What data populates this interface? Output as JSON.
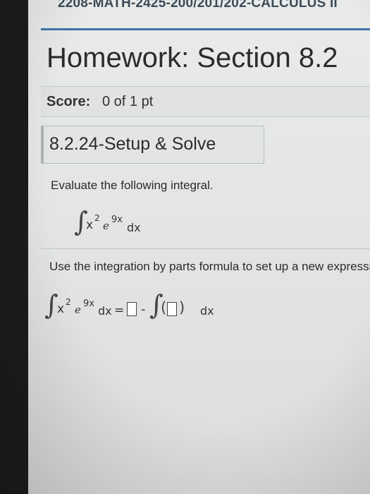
{
  "header": {
    "course_title": "2208-MATH-2425-200/201/202-CALCULUS II",
    "homework_title": "Homework: Section 8.2"
  },
  "score": {
    "label": "Score:",
    "value": "0 of 1 pt"
  },
  "question": {
    "id_label": "8.2.24-Setup & Solve",
    "prompt": "Evaluate the following integral.",
    "integral": {
      "integral_sign": "∫",
      "base": "x",
      "base_power": "2",
      "exp_base": "e",
      "exponent": "9x",
      "differential": "dx"
    },
    "instruction": "Use the integration by parts formula to set up a new expression.",
    "setup": {
      "equals": "=",
      "minus": "-",
      "open_paren": "(",
      "close_paren": ")",
      "differential": "dx"
    }
  },
  "colors": {
    "accent_rule": "#3f74a7",
    "screen_bg": "#e7e9e9",
    "text": "#2b2b2b"
  }
}
